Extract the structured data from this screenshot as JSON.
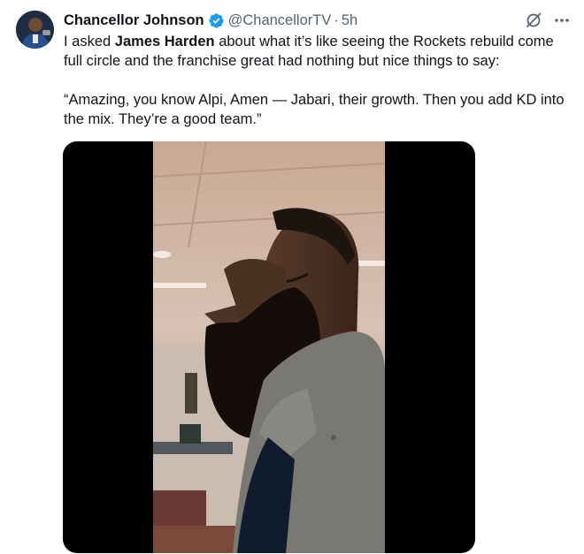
{
  "author": {
    "name": "Chancellor Johnson",
    "handle": "@ChancellorTV",
    "separator": "·",
    "time": "5h"
  },
  "tweet": {
    "intro_before": "I asked ",
    "intro_bold": "James Harden",
    "intro_after": " about what it’s like seeing the Rockets rebuild come full circle and the franchise great had nothing but nice things to say:",
    "quote": "“Amazing, you know Alpi, Amen — Jabari, their growth. Then you add KD into the mix. They’re a good team.”"
  },
  "icons": {
    "verified": "verified-badge-icon",
    "grok": "grok-icon",
    "more": "more-options-icon"
  },
  "colors": {
    "verified": "#1d9bf0",
    "secondary_text": "#536471",
    "primary_text": "#0f1419",
    "media_background": "#000000"
  }
}
